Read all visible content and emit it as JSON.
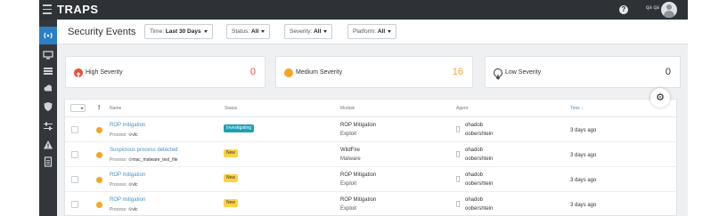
{
  "topbar": {
    "logo": "TRAPS",
    "help_icon": "?",
    "user": "qa qa"
  },
  "sidebar": {
    "items": [
      {
        "icon": "broadcast-icon",
        "active": true
      },
      {
        "icon": "monitor-icon",
        "active": false
      },
      {
        "icon": "list-icon",
        "active": false
      },
      {
        "icon": "cloud-icon",
        "active": false
      },
      {
        "icon": "shield-icon",
        "active": false
      },
      {
        "icon": "sliders-icon",
        "active": false
      },
      {
        "icon": "warning-icon",
        "active": false
      },
      {
        "icon": "document-icon",
        "active": false
      }
    ]
  },
  "header": {
    "title": "Security Events",
    "filters": {
      "time": {
        "label": "Time:",
        "value": "Last 30 Days"
      },
      "status": {
        "label": "Status:",
        "value": "All"
      },
      "severity": {
        "label": "Severity:",
        "value": "All"
      },
      "platform": {
        "label": "Platform:",
        "value": "All"
      }
    }
  },
  "cards": {
    "high": {
      "label": "High Severity",
      "count": "0",
      "color": "#e8503a"
    },
    "medium": {
      "label": "Medium Severity",
      "count": "16",
      "color": "#f5a623"
    },
    "low": {
      "label": "Low Severity",
      "count": "0",
      "color": "#333333"
    }
  },
  "table": {
    "columns": {
      "name": "Name",
      "status": "Status",
      "module": "Module",
      "agent": "Agent",
      "time": "Time ↓"
    },
    "flag": "!",
    "rows": [
      {
        "name": "ROP mitigation",
        "process_label": "Process:",
        "process": "vlc",
        "status": "Investigating",
        "module": "ROP Mitigation",
        "module_type": "Exploit",
        "agent_user": "ohadob",
        "agent_host": "oobershtein",
        "time": "3 days ago"
      },
      {
        "name": "Suspicious process detected",
        "process_label": "Process:",
        "process": "mac_malware_test_file",
        "status": "New",
        "module": "WildFire",
        "module_type": "Malware",
        "agent_user": "ohadob",
        "agent_host": "oobershtein",
        "time": "3 days ago"
      },
      {
        "name": "ROP mitigation",
        "process_label": "Process:",
        "process": "vlc",
        "status": "New",
        "module": "ROP Mitigation",
        "module_type": "Exploit",
        "agent_user": "ohadob",
        "agent_host": "oobershtein",
        "time": "3 days ago"
      },
      {
        "name": "ROP mitigation",
        "process_label": "Process:",
        "process": "vlc",
        "status": "New",
        "module": "ROP Mitigation",
        "module_type": "Exploit",
        "agent_user": "ohadob",
        "agent_host": "oobershtein",
        "time": "3 days ago"
      }
    ]
  },
  "colors": {
    "accent": "#2b7fc4",
    "investigating": "#1ba0b8",
    "new": "#ffd23f"
  }
}
